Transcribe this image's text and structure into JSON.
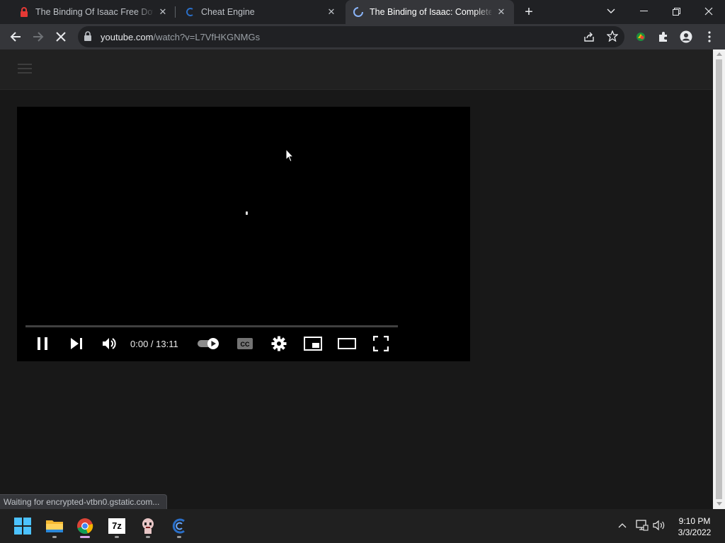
{
  "tabs": [
    {
      "title": "The Binding Of Isaac Free Downl",
      "favicon": "red-lock-icon",
      "active": false
    },
    {
      "title": "Cheat Engine",
      "favicon": "cheat-engine-icon",
      "active": false
    },
    {
      "title": "The Binding of Isaac: Complete G",
      "favicon": "loading-spinner-icon",
      "active": true
    }
  ],
  "address_bar": {
    "domain": "youtube.com",
    "path": "/watch?v=L7VfHKGNMGs"
  },
  "player": {
    "time_display": "0:00 / 13:11",
    "autoplay": "on"
  },
  "status_text": "Waiting for encrypted-vtbn0.gstatic.com...",
  "taskbar": {
    "apps": [
      "start-icon",
      "file-explorer-icon",
      "chrome-icon",
      "7zip-icon",
      "isaac-game-icon",
      "cheat-engine-icon"
    ],
    "sevenzip_label": "7z",
    "time": "9:10 PM",
    "date": "3/3/2022"
  },
  "colors": {
    "tab_strip": "#202124",
    "toolbar": "#35363a",
    "page_bg": "#181818",
    "player_bg": "#000000"
  }
}
